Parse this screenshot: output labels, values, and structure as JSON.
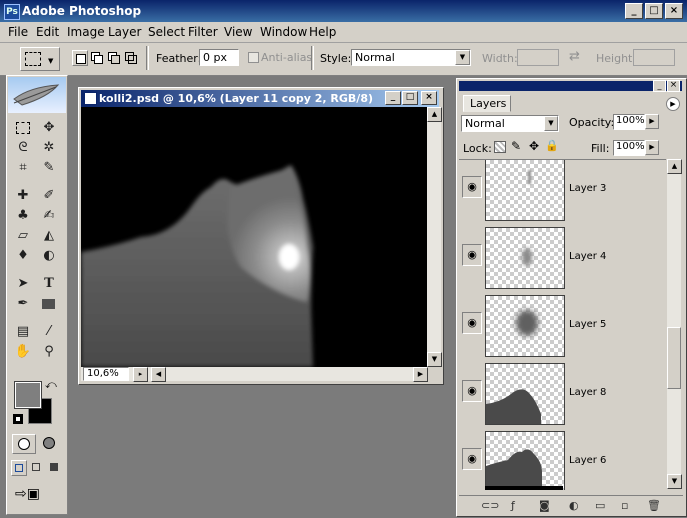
{
  "app": {
    "title": "Adobe Photoshop"
  },
  "window_buttons": {
    "minimize": "_",
    "maximize": "□",
    "close": "×"
  },
  "menu": [
    "File",
    "Edit",
    "Image",
    "Layer",
    "Select",
    "Filter",
    "View",
    "Window",
    "Help"
  ],
  "options": {
    "feather_label": "Feather:",
    "feather_value": "0 px",
    "antialias_label": "Anti-alias",
    "style_label": "Style:",
    "style_value": "Normal",
    "width_label": "Width:",
    "height_label": "Height:"
  },
  "document": {
    "title": "kolli2.psd @ 10,6% (Layer 11 copy 2, RGB/8)",
    "zoom": "10,6%"
  },
  "layers_panel": {
    "tab": "Layers",
    "blend_mode": "Normal",
    "opacity_label": "Opacity:",
    "opacity_value": "100%",
    "lock_label": "Lock:",
    "fill_label": "Fill:",
    "fill_value": "100%",
    "layers": [
      {
        "name": "Layer 3"
      },
      {
        "name": "Layer 4"
      },
      {
        "name": "Layer 5"
      },
      {
        "name": "Layer 8"
      },
      {
        "name": "Layer 6"
      }
    ]
  },
  "icons": {
    "eye": "eye-icon",
    "marquee": "rect-marquee-icon",
    "move": "move-icon",
    "lasso": "lasso-icon",
    "magic_wand": "magic-wand-icon",
    "crop": "crop-icon",
    "slice": "slice-icon",
    "heal": "healing-brush-icon",
    "brush": "brush-icon",
    "stamp": "clone-stamp-icon",
    "history_brush": "history-brush-icon",
    "eraser": "eraser-icon",
    "bucket": "paint-bucket-icon",
    "dodge": "dodge-icon",
    "blur": "blur-icon",
    "path_select": "path-selection-icon",
    "type": "type-icon",
    "pen": "pen-icon",
    "shape": "rectangle-shape-icon",
    "notes": "notes-icon",
    "eyedropper": "eyedropper-icon",
    "hand": "hand-icon",
    "zoom": "zoom-icon"
  },
  "colors": {
    "titlebar": "#0a246a",
    "chrome": "#d4d0c8",
    "workspace": "#7b7b7b",
    "foreground": "#7f7f7f",
    "background": "#000000"
  }
}
